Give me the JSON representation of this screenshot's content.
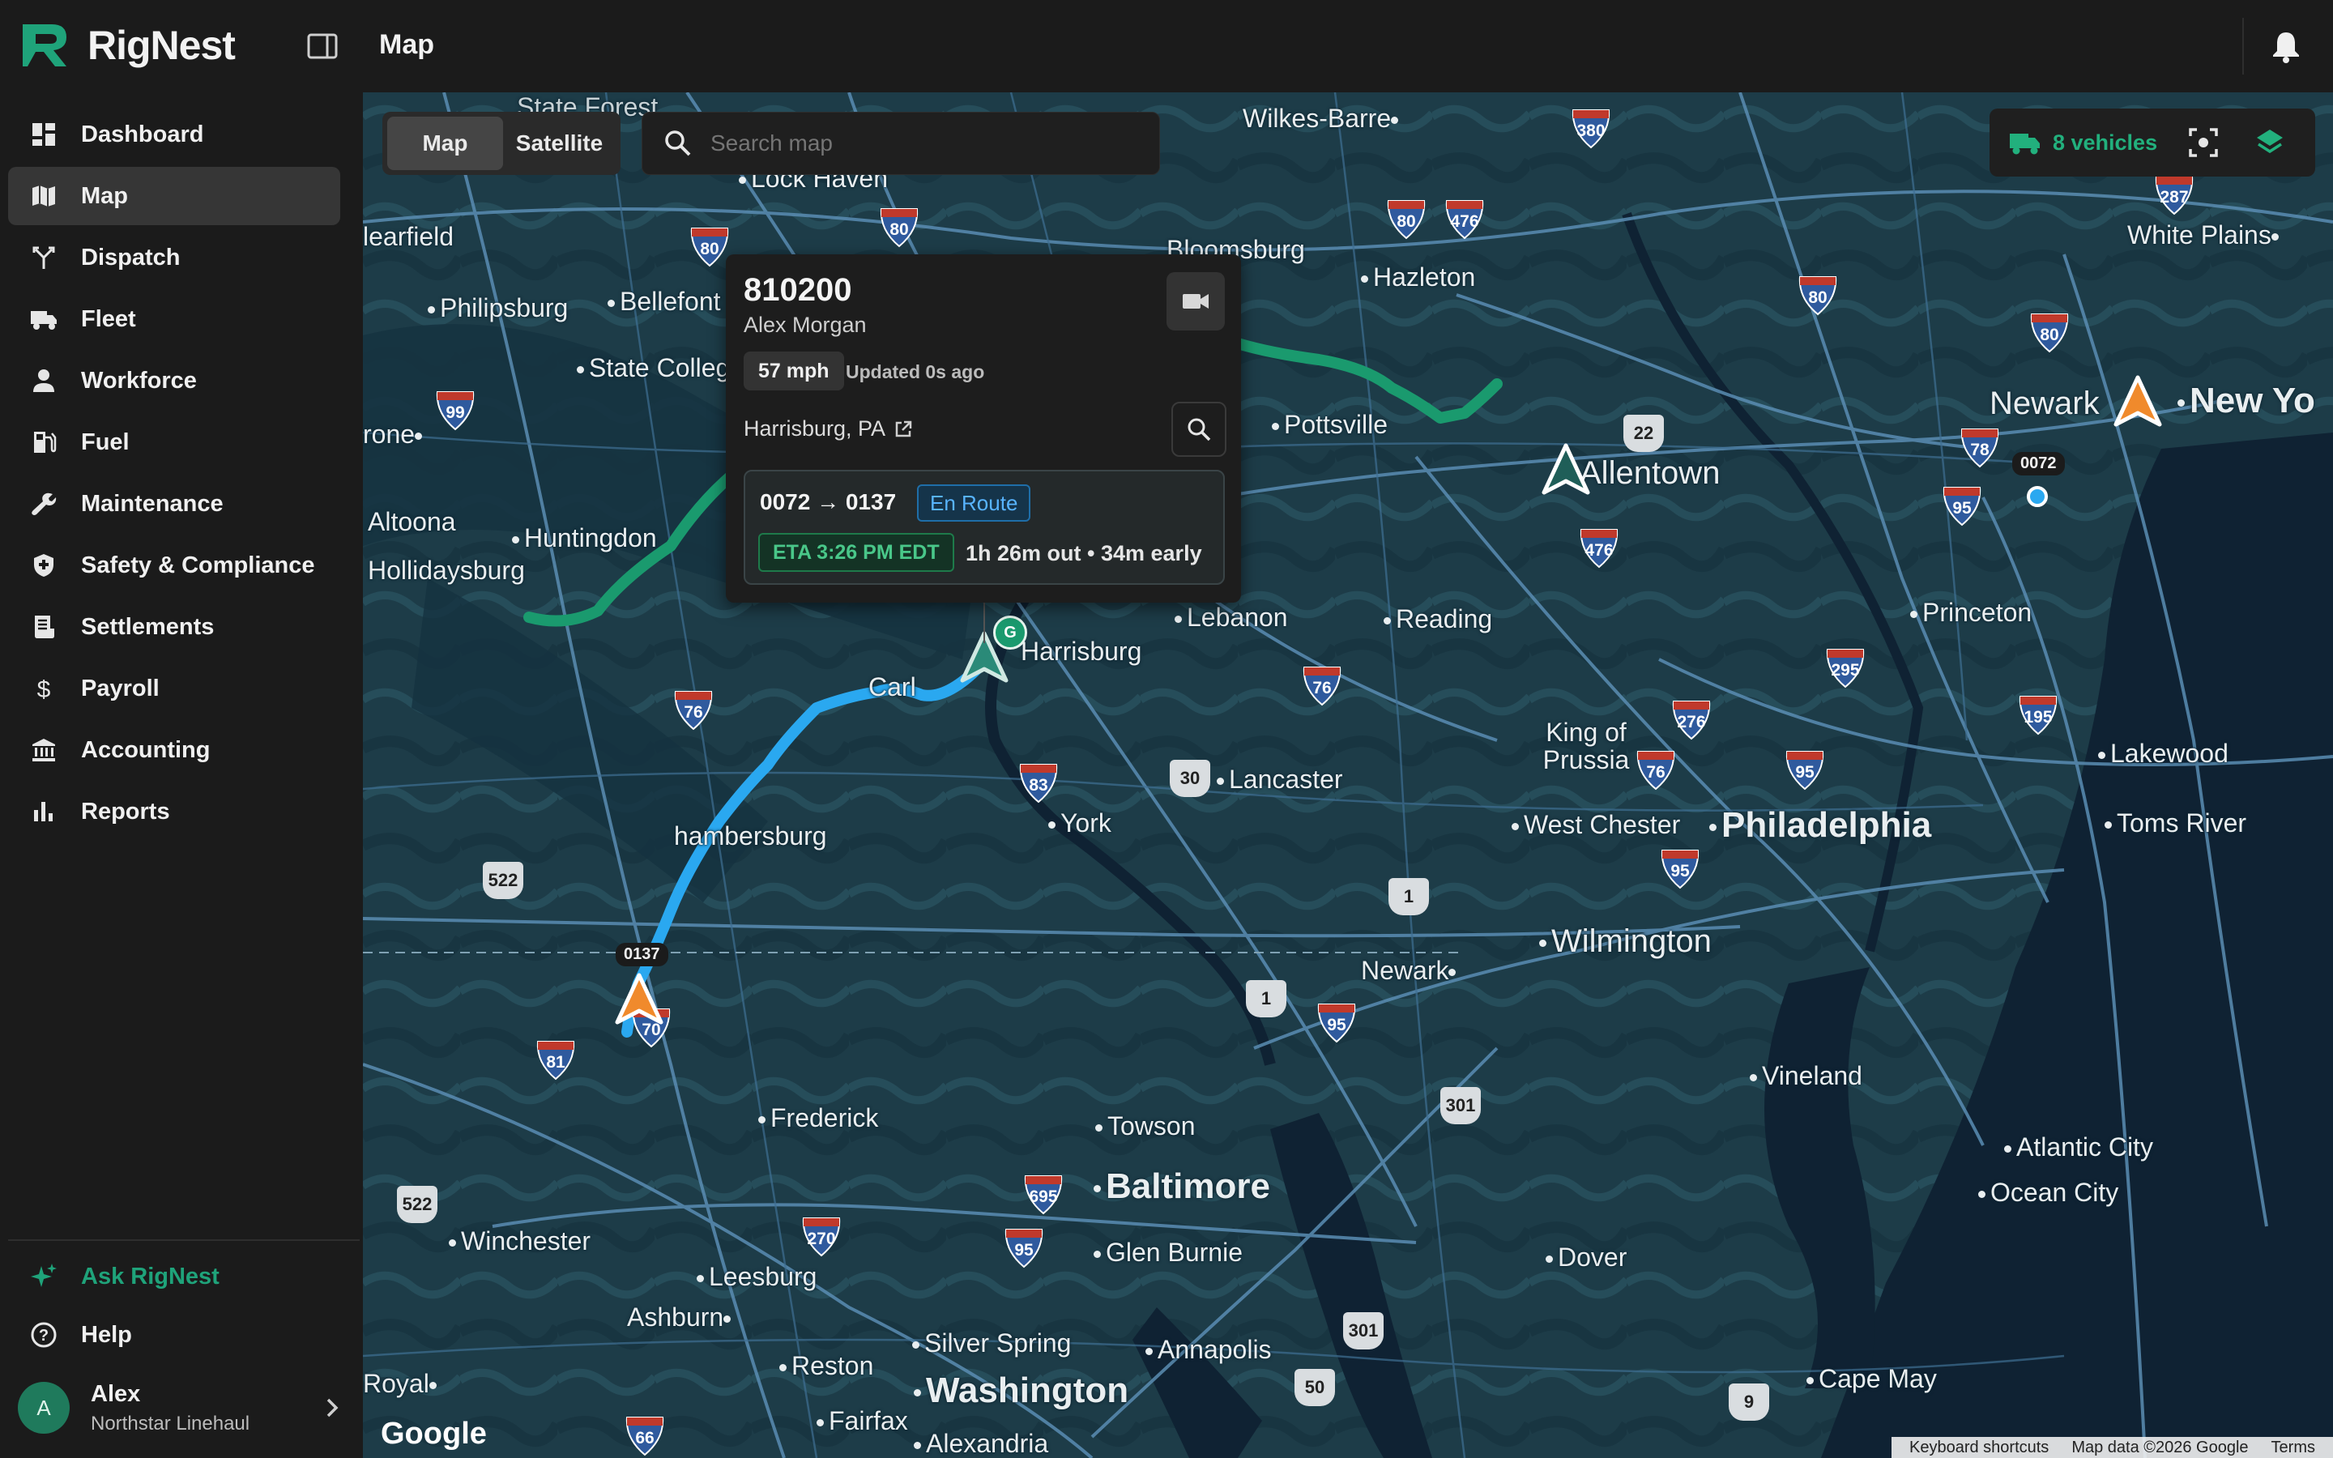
{
  "app": {
    "name": "RigNest",
    "page_title": "Map"
  },
  "nav": {
    "items": [
      {
        "label": "Dashboard",
        "icon": "dashboard-icon",
        "active": false
      },
      {
        "label": "Map",
        "icon": "map-icon",
        "active": true
      },
      {
        "label": "Dispatch",
        "icon": "dispatch-icon",
        "active": false
      },
      {
        "label": "Fleet",
        "icon": "truck-icon",
        "active": false
      },
      {
        "label": "Workforce",
        "icon": "person-icon",
        "active": false
      },
      {
        "label": "Fuel",
        "icon": "fuel-icon",
        "active": false
      },
      {
        "label": "Maintenance",
        "icon": "wrench-icon",
        "active": false
      },
      {
        "label": "Safety & Compliance",
        "icon": "shield-icon",
        "active": false
      },
      {
        "label": "Settlements",
        "icon": "receipt-icon",
        "active": false
      },
      {
        "label": "Payroll",
        "icon": "dollar-icon",
        "active": false
      },
      {
        "label": "Accounting",
        "icon": "bank-icon",
        "active": false
      },
      {
        "label": "Reports",
        "icon": "bar-chart-icon",
        "active": false
      }
    ],
    "ask_label": "Ask RigNest",
    "help_label": "Help"
  },
  "user": {
    "initial": "A",
    "name": "Alex",
    "org": "Northstar Linehaul"
  },
  "map_controls": {
    "map_label": "Map",
    "satellite_label": "Satellite",
    "search_placeholder": "Search map",
    "vehicles_label": "8 vehicles"
  },
  "popup": {
    "truck_id": "810200",
    "driver": "Alex Morgan",
    "speed": "57 mph",
    "updated": "Updated 0s ago",
    "location": "Harrisburg, PA",
    "route": "0072 → 0137",
    "status": "En Route",
    "eta": "ETA 3:26 PM EDT",
    "eta_detail": "1h 26m out • 34m early"
  },
  "vehicle_labels": {
    "a": "0072",
    "b": "0137",
    "g": "G"
  },
  "map_labels": {
    "state_forest": "State Forest",
    "wilkes_barre": "Wilkes-Barre",
    "lock_haven": "Lock Haven",
    "bloomsburg": "Bloomsburg",
    "hazleton": "Hazleton",
    "white_plains": "White Plains",
    "clearfield": "learfield",
    "philipsburg": "Philipsburg",
    "bellefonte": "Bellefont",
    "state_college": "State Colleg",
    "pottsville": "Pottsville",
    "newark_nj": "Newark",
    "new_york": "New Yo",
    "allentown": "Allentown",
    "altoona": "Altoona",
    "huntingdon": "Huntingdon",
    "hollidaysburg": "Hollidaysburg",
    "lebanon": "Lebanon",
    "reading": "Reading",
    "princeton": "Princeton",
    "harrisburg": "Harrisburg",
    "carlisle": "Carl",
    "king_of_prussia": "King of Prussia",
    "lancaster": "Lancaster",
    "lakewood": "Lakewood",
    "york": "York",
    "west_chester": "West Chester",
    "philadelphia": "Philadelphia",
    "toms_river": "Toms River",
    "chambersburg": "hambersburg",
    "wilmington": "Wilmington",
    "newark_de": "Newark",
    "vineland": "Vineland",
    "frederick": "Frederick",
    "towson": "Towson",
    "atlantic_city": "Atlantic City",
    "baltimore": "Baltimore",
    "ocean_city": "Ocean City",
    "winchester": "Winchester",
    "glen_burnie": "Glen Burnie",
    "dover": "Dover",
    "leesburg": "Leesburg",
    "ashburn": "Ashburn",
    "silver_spring": "Silver Spring",
    "annapolis": "Annapolis",
    "royal": "Royal",
    "reston": "Reston",
    "washington": "Washington",
    "cape_may": "Cape May",
    "fairfax": "Fairfax",
    "alexandria": "Alexandria",
    "tyrone": "rone"
  },
  "shields": [
    "380",
    "80",
    "476",
    "287",
    "80",
    "80",
    "80",
    "99",
    "476",
    "22",
    "78",
    "95",
    "76",
    "83",
    "276",
    "295",
    "76",
    "195",
    "95",
    "76",
    "95",
    "81",
    "70",
    "270",
    "695",
    "95",
    "66"
  ],
  "us_shields": [
    "522",
    "30",
    "1",
    "1",
    "301",
    "522",
    "301",
    "50",
    "9"
  ],
  "footer": {
    "shortcuts": "Keyboard shortcuts",
    "map_data": "Map data ©2026 Google",
    "terms": "Terms",
    "google": "Google"
  },
  "colors": {
    "accent": "#1fa37a",
    "route_green": "#1a9a6e",
    "route_blue": "#2aa8f0",
    "marker_orange": "#f08a2c"
  }
}
